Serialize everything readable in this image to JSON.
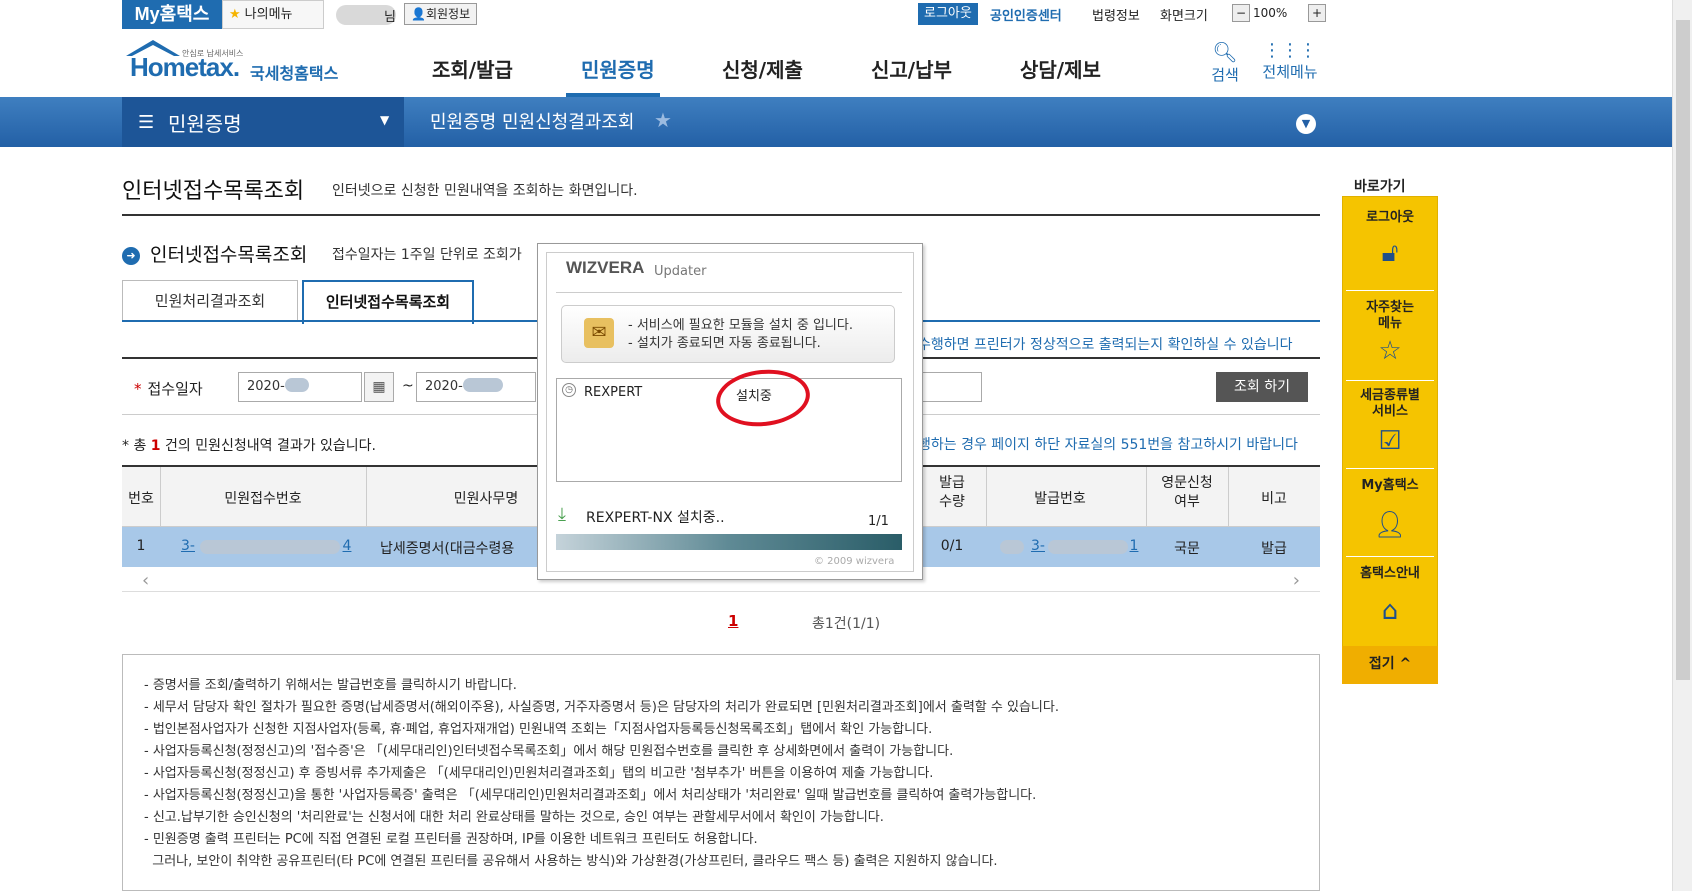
{
  "util": {
    "my_hometax": "My홈택스",
    "my_menu": "나의메뉴",
    "nim": "님",
    "member_info": "회원정보",
    "logout": "로그아웃",
    "cert_center": "공인인증센터",
    "law_info": "법령정보",
    "screen_size": "화면크기",
    "zoom_minus": "−",
    "zoom_value": "100%",
    "zoom_plus": "+"
  },
  "header": {
    "logo_text": "Hometax.",
    "logo_kr": "국세청홈택스",
    "logo_sub": "안심로 납세서비스",
    "gnb": [
      "조회/발급",
      "민원증명",
      "신청/제출",
      "신고/납부",
      "상담/제보"
    ],
    "gnb_active": 1,
    "search": "검색",
    "all_menu": "전체메뉴"
  },
  "nav": {
    "menu": "민원증명",
    "breadcrumb": "민원증명 민원신청결과조회"
  },
  "page": {
    "title": "인터넷접수목록조회",
    "desc": "인터넷으로 신청한 민원내역을 조회하는 화면입니다.",
    "section_title": "인터넷접수목록조회",
    "section_desc": "접수일자는 1주일 단위로 조회가",
    "tabs": [
      "민원처리결과조회",
      "인터넷접수목록조회"
    ],
    "tab_active": 1,
    "print_note": "수행하면 프린터가 정상적으로 출력되는지 확인하실 수 있습니다",
    "search_label": "접수일자",
    "date_from": "2020-",
    "date_to": "2020-",
    "tilde": "~",
    "query_button": "조회 하기",
    "result_prefix": "* 총",
    "result_count": "1",
    "result_suffix": "건의 민원신청내역 결과가 있습니다.",
    "issue_note": "행하는 경우 페이지 하단 자료실의 551번을 참고하시기 바랍니다"
  },
  "table": {
    "headers": [
      "번호",
      "민원접수번호",
      "민원사무명",
      "발급\n수량",
      "발급번호",
      "영문신청\n여부",
      "비고"
    ],
    "row": {
      "no": "1",
      "receipt_no_start": "3-",
      "receipt_no_end": "4",
      "name": "납세증명서(대금수령용",
      "qty": "0/1",
      "issue_no_start": "3-",
      "issue_no_end": "1",
      "english": "국문",
      "remark": "발급"
    }
  },
  "pager": {
    "current": "1",
    "total": "총1건(1/1)"
  },
  "notes": [
    "- 증명서를 조회/출력하기 위해서는 발급번호를 클릭하시기 바랍니다.",
    "- 세무서 담당자 확인 절차가 필요한 증명(납세증명서(해외이주용), 사실증명, 거주자증명서 등)은 담당자의 처리가 완료되면 [민원처리결과조회]에서 출력할 수 있습니다.",
    "- 법인본점사업자가 신청한 지점사업자(등록, 휴·폐업, 휴업자재개업) 민원내역 조회는「지점사업자등록등신청목록조회」탭에서 확인 가능합니다.",
    "- 사업자등록신청(정정신고)의 '접수증'은 「(세무대리인)인터넷접수목록조회」에서 해당 민원접수번호를 클릭한 후 상세화면에서 출력이 가능합니다.",
    "- 사업자등록신청(정정신고) 후 증빙서류 추가제출은 「(세무대리인)민원처리결과조회」탭의 비고란 '첨부추가' 버튼을 이용하여 제출 가능합니다.",
    "- 사업자등록신청(정정신고)을 통한 '사업자등록증' 출력은 「(세무대리인)민원처리결과조회」에서 처리상태가 '처리완료' 일때 발급번호를 클릭하여 출력가능합니다.",
    "- 신고.납부기한 승인신청의 '처리완료'는 신청서에 대한 처리 완료상태를 말하는 것으로, 승인 여부는 관할세무서에서 확인이 가능합니다.",
    "- 민원증명 출력 프린터는 PC에 직접 연결된 로컬 프린터를 권장하며, IP를 이용한 네트워크 프린터도 허용합니다.",
    "  그러나, 보안이 취약한 공유프린터(타 PC에 연결된 프린터를 공유해서 사용하는 방식)와 가상환경(가상프린터, 클라우드 팩스 등) 출력은 지원하지 않습니다."
  ],
  "quick": {
    "title": "바로가기",
    "items": [
      "로그아웃",
      "자주찾는\n메뉴",
      "세금종류별\n서비스",
      "My홈택스",
      "홈택스안내"
    ],
    "icons": [
      "lock-icon",
      "star-icon",
      "checkbox-icon",
      "person-icon",
      "home-icon"
    ],
    "fold": "접기 ^"
  },
  "popup": {
    "brand": "WIZVERA",
    "brand_sub": "Updater",
    "msg1": "- 서비스에 필요한 모듈을 설치 중 입니다.",
    "msg2": "- 설치가 종료되면 자동 종료됩니다.",
    "module": "REXPERT",
    "status": "설치중",
    "download": "REXPERT-NX 설치중..",
    "count": "1/1",
    "copyright": "© 2009 wizvera"
  },
  "colors": {
    "brand_blue": "#1f6cb0",
    "quick_yellow": "#f5c400",
    "annotation_red": "#e01020"
  }
}
